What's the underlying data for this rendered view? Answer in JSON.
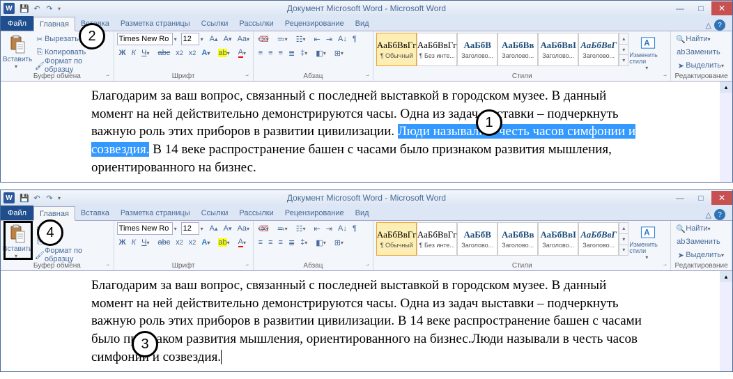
{
  "window": {
    "title": "Документ Microsoft Word - Microsoft Word",
    "app_letter": "W"
  },
  "tabs": {
    "file": "Файл",
    "home": "Главная",
    "insert": "Вставка",
    "layout": "Разметка страницы",
    "references": "Ссылки",
    "mailings": "Рассылки",
    "review": "Рецензирование",
    "view": "Вид"
  },
  "clipboard": {
    "group_label": "Буфер обмена",
    "paste": "Вставить",
    "cut": "Вырезать",
    "copy": "Копировать",
    "format_painter": "Формат по образцу"
  },
  "font": {
    "group_label": "Шрифт",
    "name": "Times New Ro",
    "size": "12"
  },
  "paragraph": {
    "group_label": "Абзац"
  },
  "styles": {
    "group_label": "Стили",
    "change": "Изменить стили",
    "preview_sample": "АаБбВвГг",
    "preview_sample2": "АаБбВ",
    "preview_sample3": "АаБбВв",
    "preview_sample4": "АаБбВвI",
    "preview_sample5": "АаБбВвГ",
    "items": [
      {
        "name": "¶ Обычный"
      },
      {
        "name": "¶ Без инте..."
      },
      {
        "name": "Заголово..."
      },
      {
        "name": "Заголово..."
      },
      {
        "name": "Заголово..."
      },
      {
        "name": "Заголово..."
      }
    ]
  },
  "editing": {
    "group_label": "Редактирование",
    "find": "Найти",
    "replace": "Заменить",
    "select": "Выделить"
  },
  "doc1": {
    "before": "Благодарим за ваш вопрос, связанный с последней выставкой в городском музее. В данный момент на ней действительно демонстрируются часы.  Одна из задач выставки – подчеркнуть важную роль этих приборов в развитии цивилизации. ",
    "highlighted": "Люди называли в честь часов симфонии и созвездия.",
    "after": " В 14 веке распространение башен с часами было признаком развития мышления, ориентированного на бизнес."
  },
  "doc2": {
    "text": "Благодарим за ваш вопрос, связанный с последней выставкой в городском музее. В данный момент на ней действительно демонстрируются часы.  Одна из задач выставки – подчеркнуть важную роль этих приборов в развитии цивилизации. В 14 веке распространение башен с часами было признаком развития мышления, ориентированного на бизнес.Люди называли в честь часов симфонии и созвездия."
  },
  "markers": {
    "m1": "1",
    "m2": "2",
    "m3": "3",
    "m4": "4"
  }
}
